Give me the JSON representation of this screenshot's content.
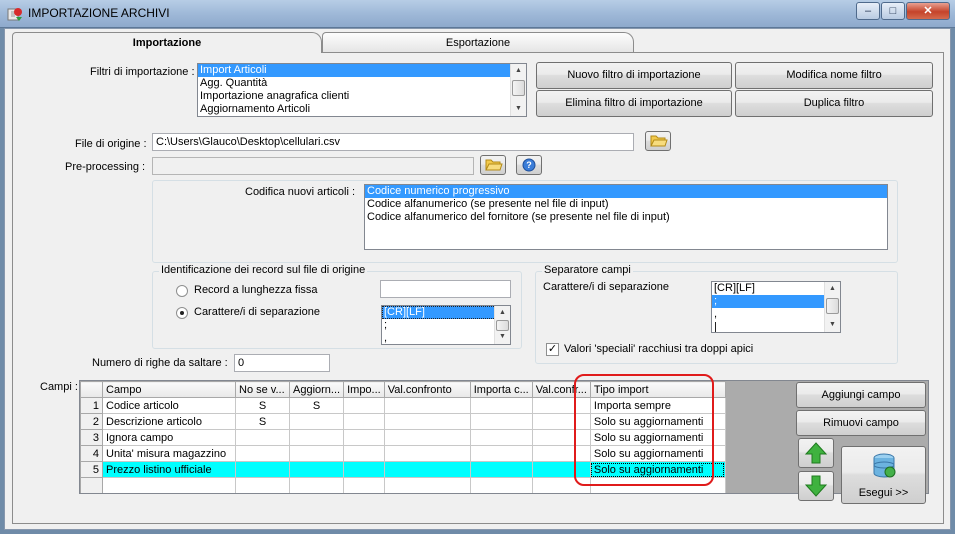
{
  "window": {
    "title": "IMPORTAZIONE ARCHIVI",
    "controls": [
      "–",
      "□",
      "✕"
    ]
  },
  "tabs": [
    {
      "label": "Importazione",
      "active": true
    },
    {
      "label": "Esportazione",
      "active": false
    }
  ],
  "filters": {
    "label": "Filtri di importazione :",
    "items": [
      "Import Articoli",
      "Agg. Quantità",
      "Importazione anagrafica clienti",
      "Aggiornamento Articoli"
    ],
    "selected_index": 0
  },
  "filter_buttons": {
    "new": "Nuovo filtro di importazione",
    "rename": "Modifica nome filtro",
    "delete": "Elimina filtro di importazione",
    "duplicate": "Duplica filtro"
  },
  "source_file": {
    "label": "File di origine :",
    "value": "C:\\Users\\Glauco\\Desktop\\cellulari.csv"
  },
  "preprocessing": {
    "label": "Pre-processing :",
    "value": ""
  },
  "codifica": {
    "label": "Codifica nuovi articoli :",
    "items": [
      "Codice numerico progressivo",
      "Codice alfanumerico (se presente nel file di input)",
      "Codice alfanumerico del fornitore (se presente nel file di input)"
    ],
    "selected_index": 0
  },
  "record_id": {
    "title": "Identificazione dei record sul file di origine",
    "fixed_label": "Record a lunghezza fissa",
    "fixed_value": "",
    "sep_label": "Carattere/i di separazione",
    "sep_items": [
      "[CR][LF]",
      ";",
      ","
    ],
    "sep_selected_index": 0,
    "selected_option": "separator"
  },
  "field_sep": {
    "title": "Separatore campi",
    "label": "Carattere/i di separazione",
    "items": [
      "[CR][LF]",
      ";",
      ",",
      "|"
    ],
    "selected_index": 1,
    "quote_label": "Valori 'speciali' racchiusi tra doppi apici",
    "quote_checked": true
  },
  "skip_rows": {
    "label": "Numero di righe da saltare :",
    "value": "0"
  },
  "campi": {
    "label": "Campi :",
    "columns": [
      "Campo",
      "No se v...",
      "Aggiorn...",
      "Impo...",
      "Val.confronto",
      "Importa c...",
      "Val.confr...",
      "Tipo import"
    ],
    "rows": [
      {
        "n": "1",
        "cells": [
          "Codice articolo",
          "S",
          "S",
          "",
          "",
          "",
          "",
          "Importa sempre"
        ]
      },
      {
        "n": "2",
        "cells": [
          "Descrizione articolo",
          "S",
          "",
          "",
          "",
          "",
          "",
          "Solo su aggiornamenti"
        ]
      },
      {
        "n": "3",
        "cells": [
          "Ignora campo",
          "",
          "",
          "",
          "",
          "",
          "",
          "Solo su aggiornamenti"
        ]
      },
      {
        "n": "4",
        "cells": [
          "Unita' misura magazzino",
          "",
          "",
          "",
          "",
          "",
          "",
          "Solo su aggiornamenti"
        ]
      },
      {
        "n": "5",
        "cells": [
          "Prezzo listino ufficiale",
          "",
          "",
          "",
          "",
          "",
          "",
          "Solo su aggiornamenti"
        ]
      }
    ],
    "selected_row": 4
  },
  "side_buttons": {
    "add": "Aggiungi campo",
    "remove": "Rimuovi campo",
    "run": "Esegui >>"
  },
  "colors": {
    "selection": "#3399ff",
    "row_highlight": "#00ffff",
    "annotation": "#e01b1b"
  }
}
